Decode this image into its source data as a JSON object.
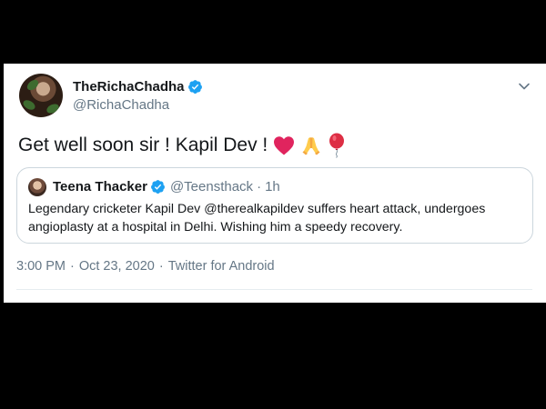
{
  "author": {
    "name": "TheRichaChadha",
    "handle": "@RichaChadha"
  },
  "tweet": {
    "text": "Get well soon sir ! Kapil Dev !",
    "emojis": [
      "red-heart-icon",
      "folded-hands-icon",
      "balloon-icon"
    ]
  },
  "quoted_tweet": {
    "name": "Teena Thacker",
    "handle": "@Teensthack",
    "separator": "·",
    "age": "1h",
    "text": "Legendary cricketer Kapil Dev @therealkapildev suffers heart attack, undergoes angioplasty at a hospital in Delhi. Wishing him a speedy recovery."
  },
  "footer": {
    "time": "3:00 PM",
    "separator": "·",
    "date": "Oct 23, 2020",
    "source": "Twitter for Android"
  },
  "colors": {
    "background": "#000000",
    "card": "#ffffff",
    "text_primary": "#14171a",
    "text_secondary": "#657786",
    "verified_blue": "#1da1f2",
    "heart_red": "#e0245e"
  }
}
